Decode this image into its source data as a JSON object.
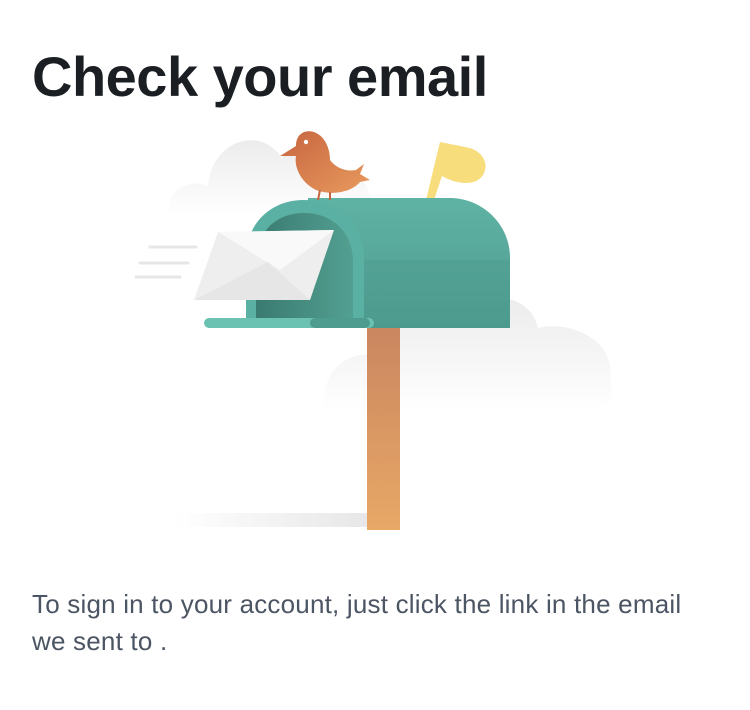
{
  "title": "Check your email",
  "message": {
    "prefix": "To sign in to your account, just click the link in the email we sent to ",
    "email": "",
    "suffix": "."
  },
  "illustration": {
    "subject": "mailbox-with-envelope-and-bird",
    "colors": {
      "mailbox": "#56a89a",
      "mailbox_dark": "#3f8478",
      "post": "#d99a5e",
      "bird": "#d9794a",
      "flag": "#f7dd7c",
      "envelope": "#f2f2f2",
      "cloud": "#efefef"
    }
  }
}
